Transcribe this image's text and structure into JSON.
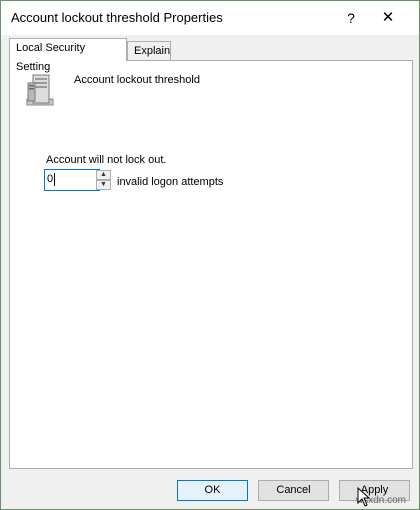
{
  "window": {
    "title": "Account lockout threshold Properties",
    "help_glyph": "?",
    "close_glyph": "✕"
  },
  "tabs": [
    {
      "label": "Local Security Setting",
      "active": true
    },
    {
      "label": "Explain",
      "active": false
    }
  ],
  "policy": {
    "icon": "server-icon",
    "heading": "Account lockout threshold",
    "status_text": "Account will not lock out.",
    "value": "0",
    "suffix": "invalid logon attempts",
    "spin_up_glyph": "▲",
    "spin_down_glyph": "▼"
  },
  "buttons": {
    "ok": "OK",
    "cancel": "Cancel",
    "apply": "Apply"
  },
  "watermark": "wsxdn.com",
  "colors": {
    "accent": "#0078d7",
    "dialog_bg": "#f0f0f0",
    "panel_bg": "#ffffff"
  }
}
